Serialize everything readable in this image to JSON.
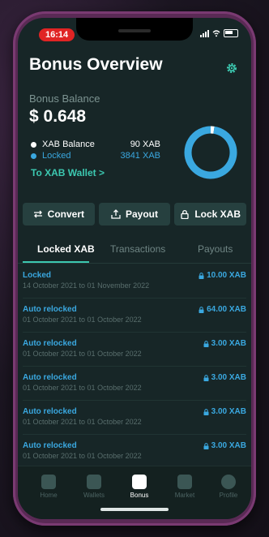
{
  "status": {
    "time": "16:14"
  },
  "header": {
    "title": "Bonus Overview",
    "settings_icon": "gear-icon"
  },
  "balance": {
    "label": "Bonus Balance",
    "value": "$ 0.648"
  },
  "legend": [
    {
      "name": "XAB Balance",
      "value": "90 XAB",
      "color": "#ffffff"
    },
    {
      "name": "Locked",
      "value": "3841 XAB",
      "color": "#3aa8e0"
    }
  ],
  "wallet_link": "To XAB Wallet  >",
  "chart_data": {
    "type": "pie",
    "categories": [
      "XAB Balance",
      "Locked"
    ],
    "values": [
      90,
      3841
    ],
    "colors": [
      "#ffffff",
      "#3aa8e0"
    ],
    "style": "donut"
  },
  "actions": {
    "convert": "Convert",
    "payout": "Payout",
    "lock": "Lock XAB"
  },
  "tabs": {
    "locked": "Locked XAB",
    "transactions": "Transactions",
    "payouts": "Payouts"
  },
  "items": [
    {
      "title": "Locked",
      "date": "14 October 2021 to 01 November 2022",
      "amount": "10.00 XAB"
    },
    {
      "title": "Auto relocked",
      "date": "01 October 2021 to 01 October 2022",
      "amount": "64.00 XAB"
    },
    {
      "title": "Auto relocked",
      "date": "01 October 2021 to 01 October 2022",
      "amount": "3.00 XAB"
    },
    {
      "title": "Auto relocked",
      "date": "01 October 2021 to 01 October 2022",
      "amount": "3.00 XAB"
    },
    {
      "title": "Auto relocked",
      "date": "01 October 2021 to 01 October 2022",
      "amount": "3.00 XAB"
    },
    {
      "title": "Auto relocked",
      "date": "01 October 2021 to 01 October 2022",
      "amount": "3.00 XAB"
    }
  ],
  "nav": {
    "home": "Home",
    "wallets": "Wallets",
    "bonus": "Bonus",
    "market": "Market",
    "profile": "Profile"
  }
}
